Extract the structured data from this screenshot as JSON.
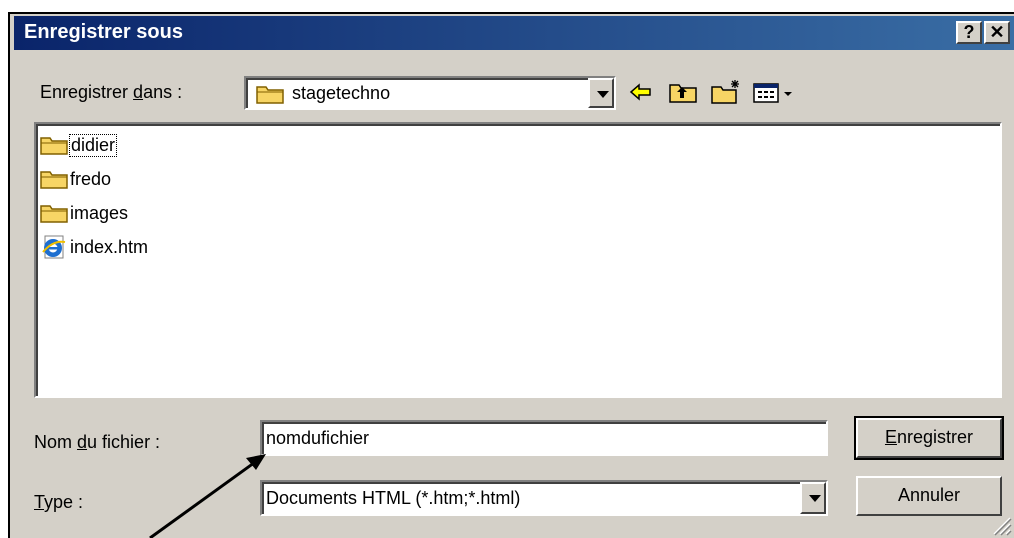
{
  "dialog": {
    "title": "Enregistrer sous",
    "help_button": "?",
    "close_button": "✕"
  },
  "location": {
    "label_prefix": "Enregistrer ",
    "label_mnemonic": "d",
    "label_suffix": "ans :",
    "folder": "stagetechno"
  },
  "files": [
    {
      "name": "didier",
      "icon": "folder-icon"
    },
    {
      "name": "fredo",
      "icon": "folder-icon"
    },
    {
      "name": "images",
      "icon": "folder-icon"
    },
    {
      "name": "index.htm",
      "icon": "ie-document-icon"
    }
  ],
  "filename": {
    "label_prefix": "Nom ",
    "label_mnemonic": "d",
    "label_suffix": "u fichier :",
    "value": "nomdufichier"
  },
  "filetype": {
    "label_mnemonic": "T",
    "label_suffix": "ype :",
    "value": "Documents HTML (*.htm;*.html)"
  },
  "buttons": {
    "save_mnemonic": "E",
    "save_rest": "nregistrer",
    "cancel": "Annuler"
  },
  "colors": {
    "titlebar": "#0a246a",
    "face": "#d4d0c8",
    "folder": "#f7d565"
  }
}
